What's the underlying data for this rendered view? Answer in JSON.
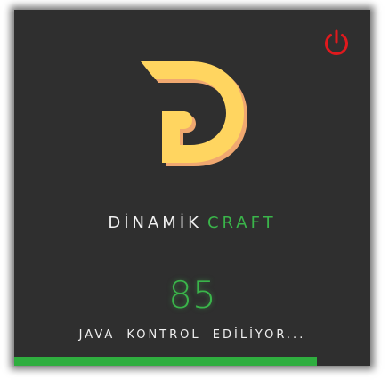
{
  "window": {
    "brand_first": "DİNAMİK",
    "brand_second": "CRAFT",
    "progress_value": "85",
    "status_text": "JAVA KONTROL EDİLİYOR..."
  },
  "progress": {
    "fraction": 0.85
  },
  "icons": {
    "power": "power-icon",
    "logo": "dinamik-d-logo"
  },
  "colors": {
    "background": "#2f2f2f",
    "accent_green": "#3ab54a",
    "power_red": "#e0191d",
    "logo_yellow": "#ffd560",
    "logo_shadow": "#f0a870",
    "text_white": "#f2f2f2"
  }
}
